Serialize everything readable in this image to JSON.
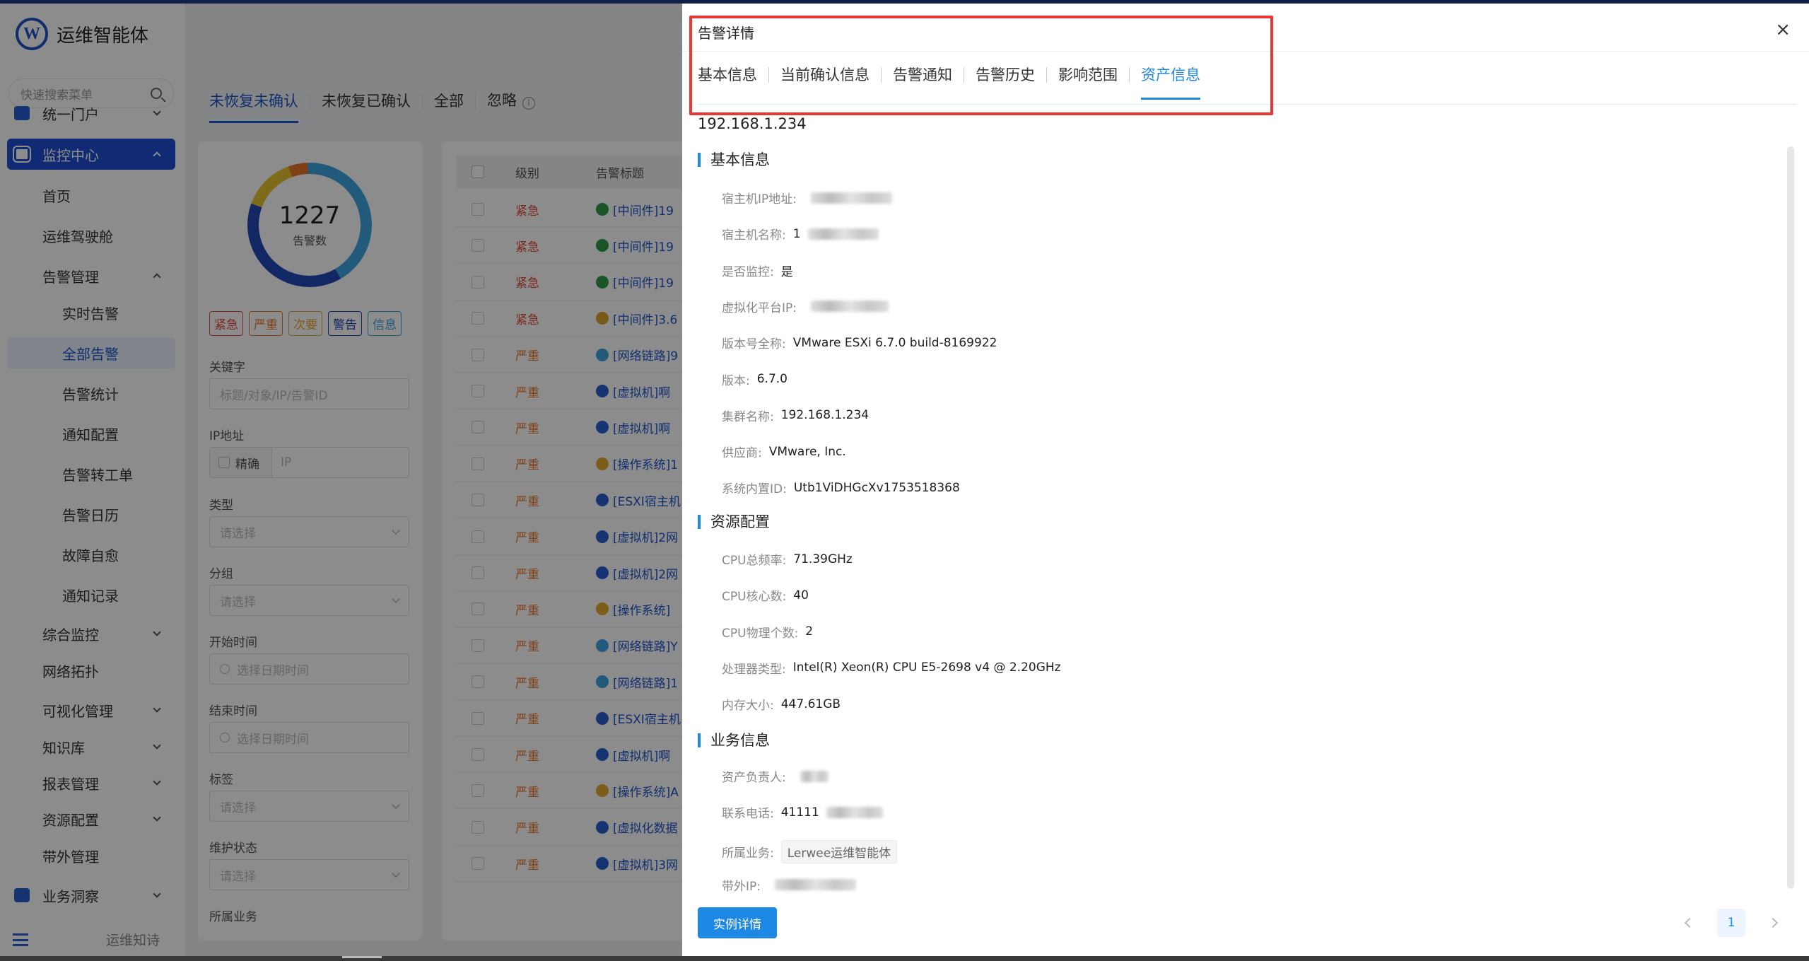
{
  "app": {
    "title": "运维智能体",
    "logo_letter": "W"
  },
  "sidebar": {
    "search_placeholder": "快速搜索菜单",
    "items": [
      {
        "label": "统一门户"
      },
      {
        "label": "监控中心"
      },
      {
        "label": "首页"
      },
      {
        "label": "运维驾驶舱"
      },
      {
        "label": "告警管理"
      },
      {
        "label": "实时告警"
      },
      {
        "label": "全部告警"
      },
      {
        "label": "告警统计"
      },
      {
        "label": "通知配置"
      },
      {
        "label": "告警转工单"
      },
      {
        "label": "告警日历"
      },
      {
        "label": "故障自愈"
      },
      {
        "label": "通知记录"
      },
      {
        "label": "综合监控"
      },
      {
        "label": "网络拓扑"
      },
      {
        "label": "可视化管理"
      },
      {
        "label": "知识库"
      },
      {
        "label": "报表管理"
      },
      {
        "label": "资源配置"
      },
      {
        "label": "带外管理"
      },
      {
        "label": "业务洞察"
      }
    ],
    "footer_text": "运维知诗"
  },
  "main": {
    "tabs": [
      "未恢复未确认",
      "未恢复已确认",
      "全部",
      "忽略"
    ],
    "summary": {
      "count": "1227",
      "label": "告警数"
    },
    "levels": [
      {
        "label": "紧急",
        "color": "#e04a3a"
      },
      {
        "label": "严重",
        "color": "#e8762a"
      },
      {
        "label": "次要",
        "color": "#e6a82f"
      },
      {
        "label": "警告",
        "color": "#1f49b8"
      },
      {
        "label": "信息",
        "color": "#3fa4e0"
      }
    ],
    "filters": {
      "keyword_label": "关键字",
      "keyword_placeholder": "标题/对象/IP/告警ID",
      "ip_label": "IP地址",
      "ip_exact": "精确",
      "ip_placeholder": "IP",
      "type_label": "类型",
      "group_label": "分组",
      "start_label": "开始时间",
      "end_label": "结束时间",
      "tag_label": "标签",
      "maint_label": "维护状态",
      "biz_label": "所属业务",
      "select_placeholder": "请选择",
      "date_placeholder": "选择日期时间"
    },
    "table": {
      "headers": [
        "级别",
        "告警标题"
      ],
      "rows": [
        {
          "level": "紧急",
          "title": "[中间件]19",
          "color": "#e04a3a",
          "icon": "#2e9b48"
        },
        {
          "level": "紧急",
          "title": "[中间件]19",
          "color": "#e04a3a",
          "icon": "#2e9b48"
        },
        {
          "level": "紧急",
          "title": "[中间件]19",
          "color": "#e04a3a",
          "icon": "#2e9b48"
        },
        {
          "level": "紧急",
          "title": "[中间件]3.6",
          "color": "#e04a3a",
          "icon": "#d9a22c"
        },
        {
          "level": "严重",
          "title": "[网络链路]9",
          "color": "#e8762a",
          "icon": "#3fa4e0"
        },
        {
          "level": "严重",
          "title": "[虚拟机]啊",
          "color": "#e8762a",
          "icon": "#2a5fd0"
        },
        {
          "level": "严重",
          "title": "[虚拟机]啊",
          "color": "#e8762a",
          "icon": "#2a5fd0"
        },
        {
          "level": "严重",
          "title": "[操作系统]1",
          "color": "#e8762a",
          "icon": "#e6a82f"
        },
        {
          "level": "严重",
          "title": "[ESXI宿主机",
          "color": "#e8762a",
          "icon": "#2a5fd0"
        },
        {
          "level": "严重",
          "title": "[虚拟机]2网",
          "color": "#e8762a",
          "icon": "#2a5fd0"
        },
        {
          "level": "严重",
          "title": "[虚拟机]2网",
          "color": "#e8762a",
          "icon": "#2a5fd0"
        },
        {
          "level": "严重",
          "title": "[操作系统]",
          "color": "#e8762a",
          "icon": "#e6a82f"
        },
        {
          "level": "严重",
          "title": "[网络链路]Y",
          "color": "#e8762a",
          "icon": "#3fa4e0"
        },
        {
          "level": "严重",
          "title": "[网络链路]1",
          "color": "#e8762a",
          "icon": "#3fa4e0"
        },
        {
          "level": "严重",
          "title": "[ESXI宿主机",
          "color": "#e8762a",
          "icon": "#2a5fd0"
        },
        {
          "level": "严重",
          "title": "[虚拟机]啊",
          "color": "#e8762a",
          "icon": "#2a5fd0"
        },
        {
          "level": "严重",
          "title": "[操作系统]A",
          "color": "#e8762a",
          "icon": "#e6a82f"
        },
        {
          "level": "严重",
          "title": "[虚拟化数据",
          "color": "#e8762a",
          "icon": "#2a5fd0"
        },
        {
          "level": "严重",
          "title": "[虚拟机]3网",
          "color": "#e8762a",
          "icon": "#2a5fd0"
        }
      ]
    }
  },
  "drawer": {
    "title": "告警详情",
    "close": "×",
    "tabs": [
      "基本信息",
      "当前确认信息",
      "告警通知",
      "告警历史",
      "影响范围",
      "资产信息"
    ],
    "active_tab": "资产信息",
    "subject": "192.168.1.234",
    "sections": {
      "basic": {
        "title": "基本信息",
        "fields": [
          {
            "k": "宿主机IP地址:",
            "v": ""
          },
          {
            "k": "宿主机名称:",
            "v": "1"
          },
          {
            "k": "是否监控:",
            "v": "是"
          },
          {
            "k": "虚拟化平台IP:",
            "v": ""
          },
          {
            "k": "版本号全称:",
            "v": "VMware ESXi 6.7.0 build-8169922"
          },
          {
            "k": "版本:",
            "v": "6.7.0"
          },
          {
            "k": "集群名称:",
            "v": "192.168.1.234"
          },
          {
            "k": "供应商:",
            "v": "VMware, Inc."
          },
          {
            "k": "系统内置ID:",
            "v": "Utb1ViDHGcXv1753518368"
          }
        ]
      },
      "resource": {
        "title": "资源配置",
        "fields": [
          {
            "k": "CPU总频率:",
            "v": "71.39GHz"
          },
          {
            "k": "CPU核心数:",
            "v": "40"
          },
          {
            "k": "CPU物理个数:",
            "v": "2"
          },
          {
            "k": "处理器类型:",
            "v": "Intel(R) Xeon(R) CPU E5-2698 v4 @ 2.20GHz"
          },
          {
            "k": "内存大小:",
            "v": "447.61GB"
          }
        ]
      },
      "business": {
        "title": "业务信息",
        "fields": [
          {
            "k": "资产负责人:",
            "v": ""
          },
          {
            "k": "联系电话:",
            "v": "41111"
          },
          {
            "k": "所属业务:",
            "v": "Lerwee运维智能体"
          },
          {
            "k": "带外IP:",
            "v": ""
          }
        ]
      }
    },
    "footer": {
      "button": "实例详情",
      "page": "1"
    }
  }
}
